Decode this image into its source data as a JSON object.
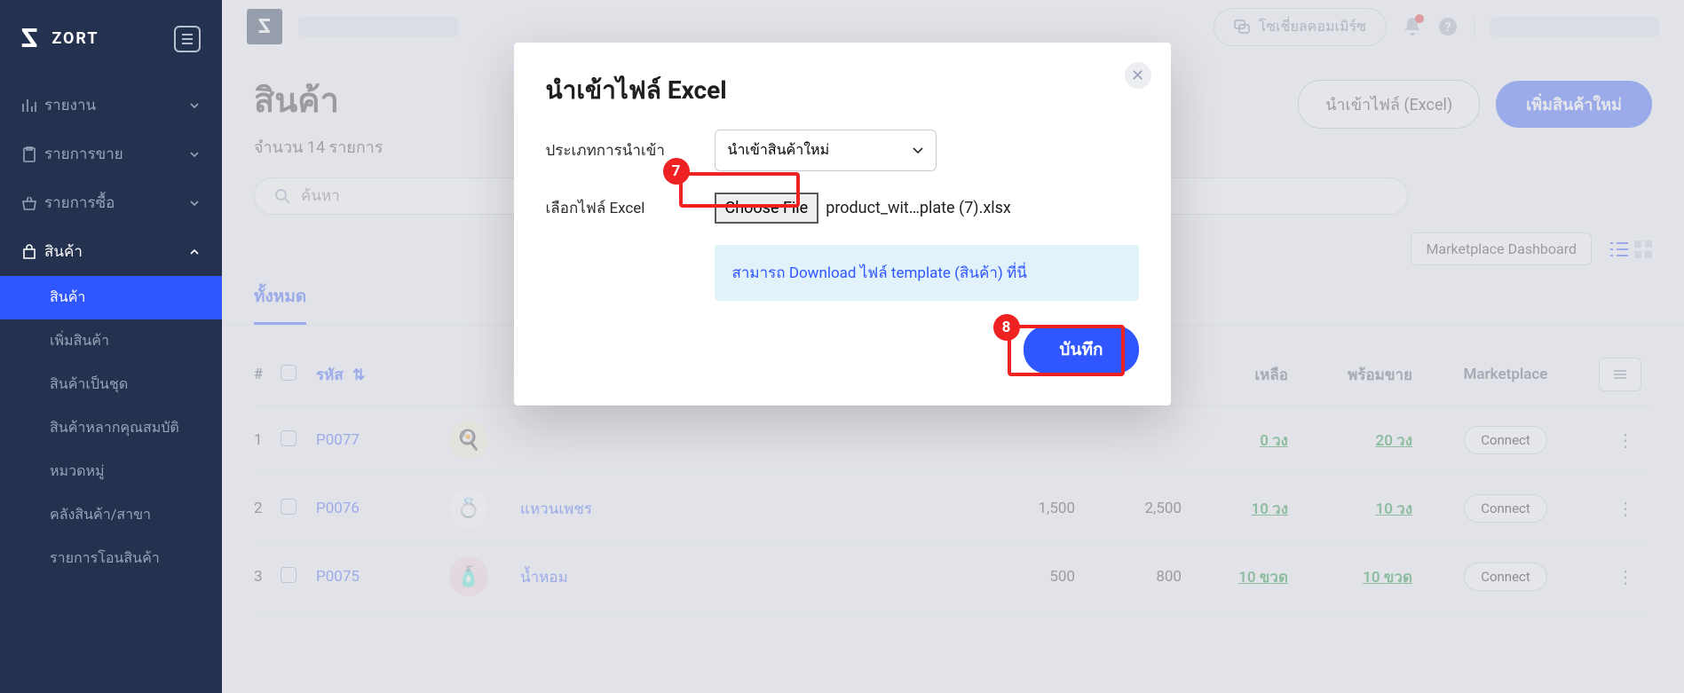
{
  "brand": {
    "name": "ZORT"
  },
  "sidebar": {
    "items": [
      {
        "label": "รายงาน",
        "icon": "chart"
      },
      {
        "label": "รายการขาย",
        "icon": "clipboard"
      },
      {
        "label": "รายการซื้อ",
        "icon": "basket"
      },
      {
        "label": "สินค้า",
        "icon": "bag"
      }
    ],
    "subitems": [
      "สินค้า",
      "เพิ่มสินค้า",
      "สินค้าเป็นชุด",
      "สินค้าหลากคุณสมบัติ",
      "หมวดหมู่",
      "คลังสินค้า/สาขา",
      "รายการโอนสินค้า"
    ]
  },
  "topbar": {
    "social": "โซเชี่ยลคอมเมิร์ซ"
  },
  "page": {
    "title": "สินค้า",
    "count_text": "จำนวน 14 รายการ",
    "import_btn": "นำเข้าไฟล์ (Excel)",
    "add_btn": "เพิ่มสินค้าใหม่",
    "search_placeholder": "ค้นหา",
    "mp_dashboard": "Marketplace Dashboard",
    "tab_all": "ทั้งหมด",
    "columns": {
      "idx": "#",
      "code": "รหัส",
      "stock": "เหลือ",
      "avail": "พร้อมขาย",
      "mkt": "Marketplace"
    },
    "rows": [
      {
        "idx": "1",
        "code": "P0077",
        "name": "",
        "p1": "",
        "p2": "",
        "stock": "0 วง",
        "avail": "20 วง",
        "emoji": "🍳"
      },
      {
        "idx": "2",
        "code": "P0076",
        "name": "แหวนเพชร",
        "p1": "1,500",
        "p2": "2,500",
        "stock": "10 วง",
        "avail": "10 วง",
        "emoji": "💍"
      },
      {
        "idx": "3",
        "code": "P0075",
        "name": "น้ำหอม",
        "p1": "500",
        "p2": "800",
        "stock": "10 ขวด",
        "avail": "10 ขวด",
        "emoji": "🧴"
      }
    ],
    "connect": "Connect"
  },
  "modal": {
    "title": "นำเข้าไฟล์ Excel",
    "type_label": "ประเภทการนำเข้า",
    "type_value": "นำเข้าสินค้าใหม่",
    "file_label": "เลือกไฟล์ Excel",
    "choose_file": "Choose File",
    "file_name": "product_wit…plate (7).xlsx",
    "template_hint": "สามารถ Download ไฟล์ template (สินค้า) ที่นี่",
    "save": "บันทึก"
  },
  "annotations": {
    "step7": "7",
    "step8": "8"
  }
}
